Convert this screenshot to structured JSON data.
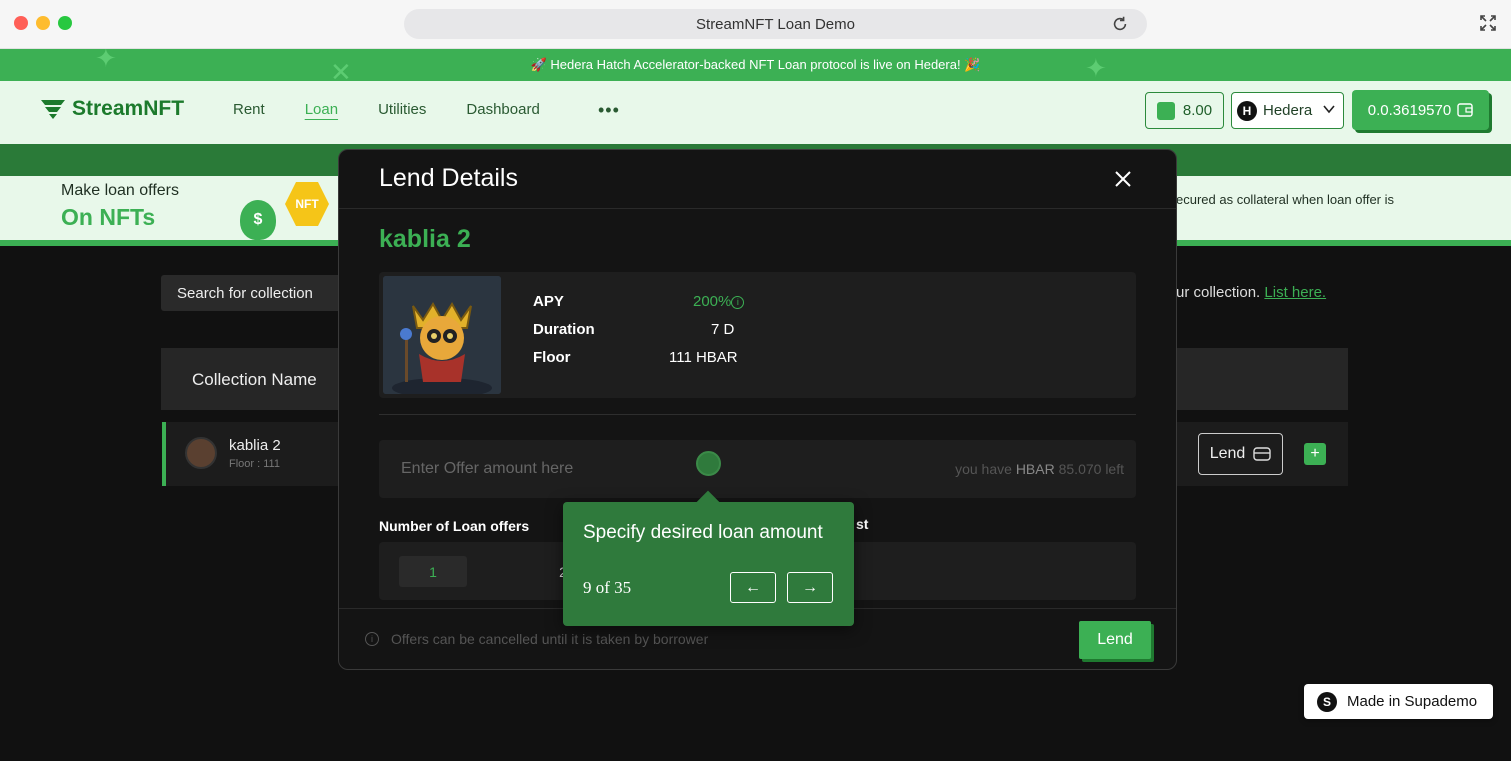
{
  "browser": {
    "title": "StreamNFT Loan Demo"
  },
  "announcement": {
    "text": "🚀 Hedera Hatch Accelerator-backed NFT Loan protocol is live on Hedera! 🎉"
  },
  "nav": {
    "logo": "StreamNFT",
    "links": [
      "Rent",
      "Loan",
      "Utilities",
      "Dashboard"
    ],
    "active_link": "Loan",
    "more": "•••",
    "balance": "8.00",
    "network": "Hedera",
    "network_icon": "H",
    "wallet": "0.0.3619570"
  },
  "hero": {
    "line1": "Make loan offers",
    "line2": "On NFTs",
    "badge": "NFT",
    "bag": "$",
    "right_text": "ecured as collateral when loan offer is"
  },
  "page": {
    "search_placeholder": "Search for collection",
    "list_hint": "ur collection.",
    "list_link": "List here.",
    "table_header": "Collection Name",
    "row": {
      "title": "kablia 2",
      "subtitle": "Floor : 111",
      "lend": "Lend",
      "plus": "+"
    }
  },
  "modal": {
    "title": "Lend Details",
    "nft_title": "kablia 2",
    "stats": {
      "apy_label": "APY",
      "apy_value": "200%",
      "duration_label": "Duration",
      "duration_value": "7 D",
      "floor_label": "Floor",
      "floor_value": "111  HBAR"
    },
    "amount_placeholder": "Enter Offer amount here",
    "have_prefix": "you have",
    "have_currency": "HBAR",
    "have_suffix": "85.070 left",
    "offers_label": "Number of Loan offers",
    "offers_label2": "st",
    "offer_options": [
      "1",
      "2"
    ],
    "foot_note": "Offers can be cancelled until it is taken by borrower",
    "lend_button": "Lend"
  },
  "tooltip": {
    "text": "Specify desired loan amount",
    "step": "9 of 35",
    "prev": "←",
    "next": "→"
  },
  "supademo": {
    "label": "Made in Supademo",
    "icon": "S"
  },
  "colors": {
    "accent": "#3cb054",
    "dark_accent": "#2f7a3c"
  }
}
